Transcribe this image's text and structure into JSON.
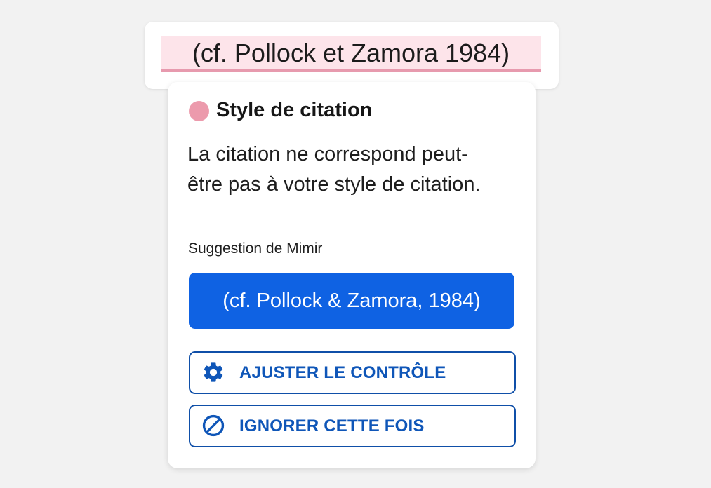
{
  "document": {
    "citation_text": "(cf. Pollock et Zamora 1984)"
  },
  "popover": {
    "title": "Style de citation",
    "message": "La citation ne correspond peut-être pas à votre style de citation.",
    "suggestion_label": "Suggestion de Mimir",
    "suggestion_button": "(cf. Pollock & Zamora, 1984)",
    "adjust_button": "AJUSTER LE CONTRÔLE",
    "ignore_button": "IGNORER CETTE FOIS",
    "icons": {
      "status": "pink-dot-icon",
      "adjust": "gear-icon",
      "ignore": "ban-icon"
    }
  },
  "colors": {
    "accent": "#0f62e3",
    "outline": "#0f4fa8",
    "highlight": "#fde4ea",
    "underline": "#e79aae",
    "status_dot": "#ec9aac"
  }
}
